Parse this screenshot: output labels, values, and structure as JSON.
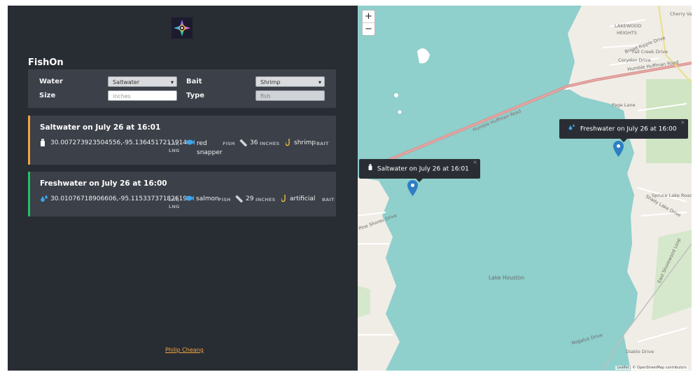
{
  "app": {
    "title": "FishOn",
    "footer_link": "Philip Cheang"
  },
  "filters": {
    "water_label": "Water",
    "water_value": "Saltwater",
    "bait_label": "Bait",
    "bait_value": "Shrimp",
    "size_label": "Size",
    "size_placeholder": "inches",
    "type_label": "Type",
    "type_placeholder": "fish"
  },
  "catches": [
    {
      "title": "Saltwater on July 26 at 16:01",
      "coords": "30.007273923504556,-95.1364517211914",
      "coords_unit": "LAT, LNG",
      "fish": "red snapper",
      "fish_unit": "FISH",
      "size": "36",
      "size_unit": "INCHES",
      "bait": "shrimp",
      "bait_unit": "BAIT",
      "accent": "#f0a542"
    },
    {
      "title": "Freshwater on July 26 at 16:00",
      "coords": "30.01076718906606,-95.11533737182619",
      "coords_unit": "LAT, LNG",
      "fish": "salmon",
      "fish_unit": "FISH",
      "size": "29",
      "size_unit": "INCHES",
      "bait": "artificial",
      "bait_unit": "BAIT",
      "accent": "#22c064"
    }
  ],
  "map": {
    "zoom_in": "+",
    "zoom_out": "−",
    "popups": {
      "salt": "Saltwater on July 26 at 16:01",
      "fresh": "Freshwater on July 26 at 16:00",
      "close": "×"
    },
    "labels": {
      "lake_houston": "Lake Houston",
      "lakewood": "LAKEWOOD",
      "heights": "HEIGHTS",
      "broad_ripple": "Broad Ripple Drive",
      "fall_creek": "Fall Creek Drive",
      "corydon": "Corydon Drive",
      "humble_huffman": "Humble Huffman Road",
      "page_lane": "Page Lane",
      "spruce_lake": "Spruce Lake Road",
      "shady_lake": "Shady Lake Drive",
      "pine_shores": "Pine Shores Drive",
      "east_shorewood": "East Shorewood Loop",
      "nogalus": "Nogalus Drive",
      "diablo": "Diablo Drive",
      "cherry_valley": "Cherry Valle",
      "bridge": "Humble Huffman Road"
    },
    "attribution": "Leaflet | © OpenStreetMap contributors"
  },
  "colors": {
    "sidebar_bg": "#282c33",
    "card_bg": "#3c4049",
    "water": "#8fcfcc",
    "marker": "#2f7ec4"
  }
}
